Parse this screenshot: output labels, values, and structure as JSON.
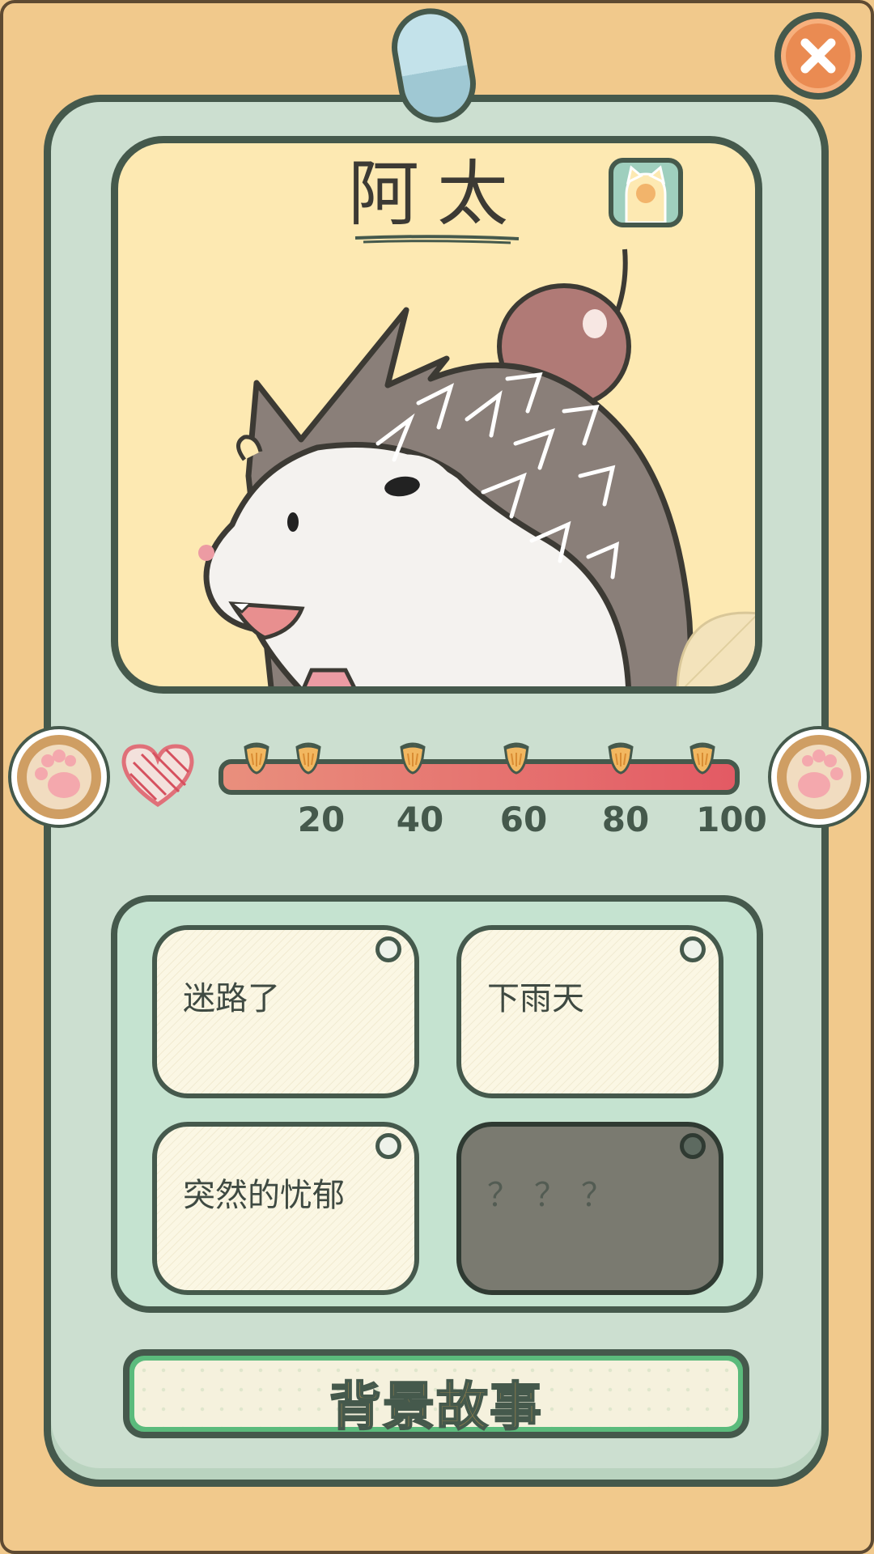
{
  "pet": {
    "name": "阿太"
  },
  "affinity": {
    "value": 100,
    "ticks": [
      "20",
      "40",
      "60",
      "80",
      "100"
    ]
  },
  "stories": [
    {
      "label": "迷路了",
      "locked": false
    },
    {
      "label": "下雨天",
      "locked": false
    },
    {
      "label": "突然的忧郁",
      "locked": false
    },
    {
      "label": "？？？",
      "locked": true
    }
  ],
  "backstory_button": {
    "label": "背景故事"
  },
  "colors": {
    "frame": "#f1c98c",
    "card": "#ccdfd0",
    "outline": "#45594c",
    "portrait_bg": "#fde9b2",
    "bar_start": "#e98f7d",
    "bar_end": "#e35a64",
    "button_border": "#5bbb7c"
  },
  "icons": {
    "close": "close-icon",
    "avatar": "cat-avatar-icon",
    "heart": "heart-icon",
    "paw": "paw-icon",
    "acorn": "acorn-icon"
  }
}
